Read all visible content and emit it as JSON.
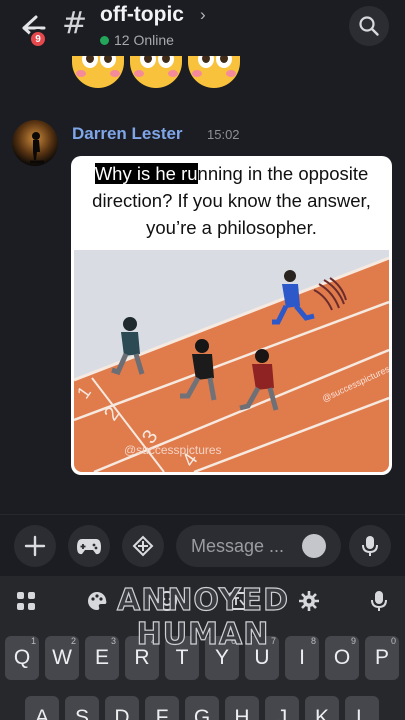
{
  "header": {
    "back_badge": "9",
    "hash": "#",
    "channel": "off-topic",
    "chevron": "›",
    "online": "12 Online"
  },
  "message": {
    "author": "Darren Lester",
    "time": "15:02",
    "caption_highlight": "Why is he ru",
    "caption_rest": "nning in the opposite direction? If you know the answer, you’re a philosopher.",
    "watermark_center": "@successpictures",
    "watermark_side": "@successpictures",
    "lane_1": "1",
    "lane_2": "2",
    "lane_3": "3",
    "lane_4": "4"
  },
  "composer": {
    "placeholder": "Message ..."
  },
  "keyboard": {
    "overlay_line1": "ANNOYED",
    "overlay_line2": "HUMAN",
    "row1": [
      {
        "k": "Q",
        "n": "1"
      },
      {
        "k": "W",
        "n": "2"
      },
      {
        "k": "E",
        "n": "3"
      },
      {
        "k": "R",
        "n": "4"
      },
      {
        "k": "T",
        "n": "5"
      },
      {
        "k": "Y",
        "n": "6"
      },
      {
        "k": "U",
        "n": "7"
      },
      {
        "k": "I",
        "n": "8"
      },
      {
        "k": "O",
        "n": "9"
      },
      {
        "k": "P",
        "n": "0"
      }
    ],
    "row2": [
      "A",
      "S",
      "D",
      "F",
      "G",
      "H",
      "J",
      "K",
      "L"
    ]
  },
  "colors": {
    "background": "#1c1d22",
    "author": "#7fa6e8",
    "online": "#23a55a",
    "badge": "#e5484d",
    "track": "#e07b4c"
  }
}
